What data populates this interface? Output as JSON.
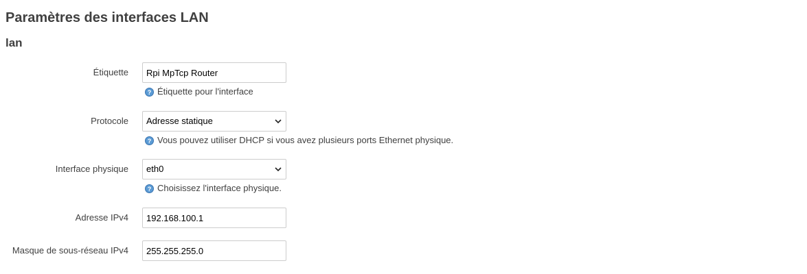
{
  "page": {
    "title": "Paramètres des interfaces LAN",
    "section": "lan"
  },
  "fields": {
    "label": {
      "label": "Étiquette",
      "value": "Rpi MpTcp Router",
      "hint": "Étiquette pour l'interface"
    },
    "protocol": {
      "label": "Protocole",
      "value": "Adresse statique",
      "hint": "Vous pouvez utiliser DHCP si vous avez plusieurs ports Ethernet physique."
    },
    "physical_interface": {
      "label": "Interface physique",
      "value": "eth0",
      "hint": "Choisissez l'interface physique."
    },
    "ipv4_address": {
      "label": "Adresse IPv4",
      "value": "192.168.100.1"
    },
    "ipv4_netmask": {
      "label": "Masque de sous-réseau IPv4",
      "value": "255.255.255.0"
    }
  },
  "icons": {
    "help": "help-icon",
    "select_arrow": "chevron-down-icon"
  },
  "colors": {
    "text": "#404040",
    "input_border": "#cccccc",
    "help_icon": "#5b9bd5"
  }
}
